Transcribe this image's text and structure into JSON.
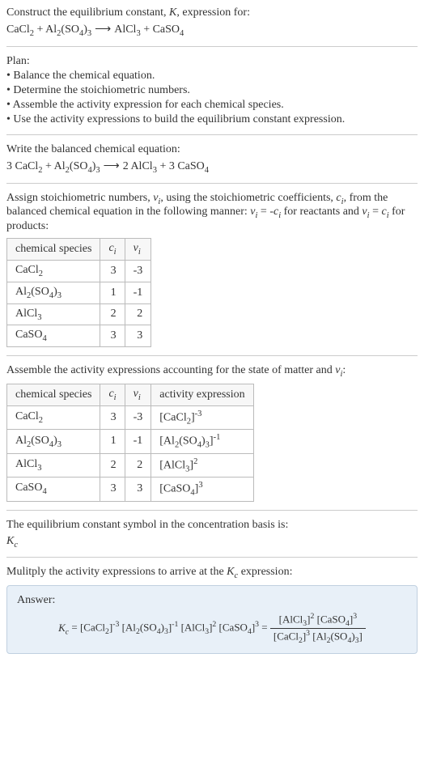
{
  "intro": {
    "line1": "Construct the equilibrium constant, K, expression for:",
    "equation": "CaCl₂ + Al₂(SO₄)₃ ⟶ AlCl₃ + CaSO₄"
  },
  "plan": {
    "label": "Plan:",
    "items": [
      "• Balance the chemical equation.",
      "• Determine the stoichiometric numbers.",
      "• Assemble the activity expression for each chemical species.",
      "• Use the activity expressions to build the equilibrium constant expression."
    ]
  },
  "balanced": {
    "text": "Write the balanced chemical equation:",
    "equation": "3 CaCl₂ + Al₂(SO₄)₃ ⟶ 2 AlCl₃ + 3 CaSO₄"
  },
  "assign": {
    "text": "Assign stoichiometric numbers, νᵢ, using the stoichiometric coefficients, cᵢ, from the balanced chemical equation in the following manner: νᵢ = -cᵢ for reactants and νᵢ = cᵢ for products:"
  },
  "table1": {
    "headers": [
      "chemical species",
      "cᵢ",
      "νᵢ"
    ],
    "rows": [
      {
        "species": "CaCl₂",
        "c": "3",
        "v": "-3"
      },
      {
        "species": "Al₂(SO₄)₃",
        "c": "1",
        "v": "-1"
      },
      {
        "species": "AlCl₃",
        "c": "2",
        "v": "2"
      },
      {
        "species": "CaSO₄",
        "c": "3",
        "v": "3"
      }
    ]
  },
  "assemble": {
    "text": "Assemble the activity expressions accounting for the state of matter and νᵢ:"
  },
  "table2": {
    "headers": [
      "chemical species",
      "cᵢ",
      "νᵢ",
      "activity expression"
    ],
    "rows": [
      {
        "species": "CaCl₂",
        "c": "3",
        "v": "-3",
        "expr": "[CaCl₂]⁻³"
      },
      {
        "species": "Al₂(SO₄)₃",
        "c": "1",
        "v": "-1",
        "expr": "[Al₂(SO₄)₃]⁻¹"
      },
      {
        "species": "AlCl₃",
        "c": "2",
        "v": "2",
        "expr": "[AlCl₃]²"
      },
      {
        "species": "CaSO₄",
        "c": "3",
        "v": "3",
        "expr": "[CaSO₄]³"
      }
    ]
  },
  "symbol": {
    "text": "The equilibrium constant symbol in the concentration basis is:",
    "value": "K_c"
  },
  "multiply": {
    "text": "Mulitply the activity expressions to arrive at the K_c expression:"
  },
  "answer": {
    "label": "Answer:",
    "lhs": "K_c = [CaCl₂]⁻³ [Al₂(SO₄)₃]⁻¹ [AlCl₃]² [CaSO₄]³ = ",
    "num": "[AlCl₃]² [CaSO₄]³",
    "den": "[CaCl₂]³ [Al₂(SO₄)₃]"
  }
}
